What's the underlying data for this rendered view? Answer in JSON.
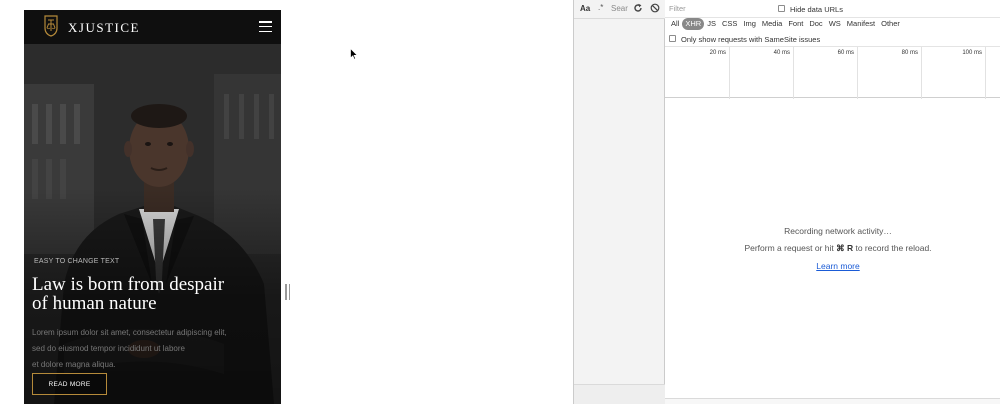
{
  "site": {
    "brand": "XJUSTICE",
    "eyebrow": "EASY TO CHANGE TEXT",
    "title_lines": [
      "Law is born from despair",
      "of human nature"
    ],
    "body_lines": [
      "Lorem ipsum dolor sit amet, consectetur adipiscing elit,",
      "sed do eiusmod tempor incididunt ut labore",
      "et dolore magna aliqua."
    ],
    "cta_label": "READ MORE",
    "accent_color": "#b58a3a"
  },
  "devtools": {
    "search": {
      "match_case_label": "Aa",
      "regex_label": ".*",
      "placeholder": "Sear"
    },
    "network": {
      "filter_placeholder": "Filter",
      "hide_data_urls_label": "Hide data URLs",
      "resource_types": [
        "All",
        "XHR",
        "JS",
        "CSS",
        "Img",
        "Media",
        "Font",
        "Doc",
        "WS",
        "Manifest",
        "Other"
      ],
      "active_type": "XHR",
      "samesite_label": "Only show requests with SameSite issues",
      "timeline_ticks": [
        "20 ms",
        "40 ms",
        "60 ms",
        "80 ms",
        "100 ms"
      ],
      "empty_title": "Recording network activity…",
      "empty_hint_before": "Perform a request or hit ",
      "empty_hint_shortcut": "⌘ R",
      "empty_hint_after": " to record the reload.",
      "learn_more_label": "Learn more"
    }
  }
}
